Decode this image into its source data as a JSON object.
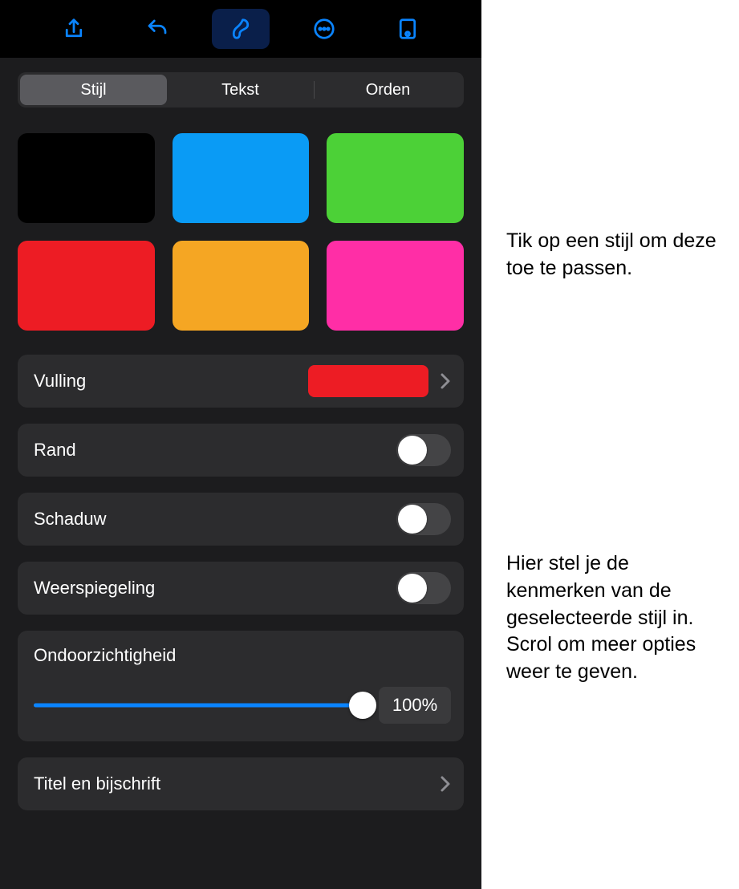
{
  "accent_color": "#0a84ff",
  "toolbar": {
    "icons": [
      "share-icon",
      "undo-icon",
      "brush-icon",
      "more-icon",
      "preview-icon"
    ],
    "active_index": 2
  },
  "tabs": {
    "items": [
      "Stijl",
      "Tekst",
      "Orden"
    ],
    "selected_index": 0
  },
  "swatches": [
    "#000000",
    "#0a9bf5",
    "#4cd137",
    "#ed1c24",
    "#f5a623",
    "#ff2ea6"
  ],
  "rows": {
    "fill": {
      "label": "Vulling",
      "color": "#ed1c24"
    },
    "border": {
      "label": "Rand",
      "on": false
    },
    "shadow": {
      "label": "Schaduw",
      "on": false
    },
    "reflection": {
      "label": "Weerspiegeling",
      "on": false
    },
    "opacity": {
      "label": "Ondoorzichtigheid",
      "value_text": "100%",
      "value": 100
    },
    "title_caption": {
      "label": "Titel en bijschrift"
    }
  },
  "callouts": {
    "apply_style": "Tik op een stijl om deze toe te passen.",
    "set_attrs": "Hier stel je de kenmerken van de geselecteerde stijl in. Scrol om meer opties weer te geven."
  }
}
